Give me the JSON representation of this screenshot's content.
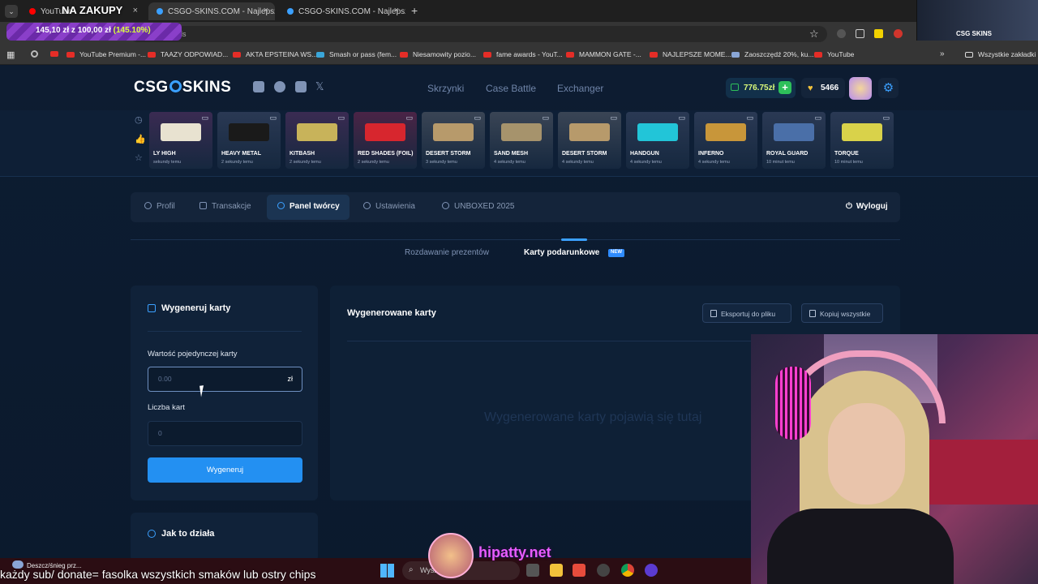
{
  "browser": {
    "tabs": [
      {
        "title": "YouTube",
        "color": "#ff0000",
        "close": "×"
      },
      {
        "title": "CSGO-SKINS.COM - Najlepsze",
        "color": "#3ba0ff",
        "close": "×"
      },
      {
        "title": "CSGO-SKINS.COM - Najlepsze",
        "color": "#3ba0ff",
        "close": "×"
      }
    ],
    "new_tab": "+",
    "url_tail": "ards",
    "bookmarks": [
      "YouTube Premium -...",
      "TAAZY ODPOWIAD...",
      "AKTA EPSTEINA WS...",
      "Smash or pass (fem...",
      "Niesamowity pozio...",
      "fame awards - YouT...",
      "MAMMON GATE -...",
      "NAJLEPSZE MOME...",
      "Zaoszczędź 20%, ku...",
      "YouTube"
    ],
    "all_bookmarks": "Wszystkie zakładki"
  },
  "overlay": {
    "title": "NA ZAKUPY",
    "donation_text": "145,10 zł z 100,00 zł",
    "donation_pct": "(145.10%)",
    "webcam_logo": "CSG SKINS",
    "weather": "Deszcz/śnieg prz...",
    "ticker": "każdy sub/ donate= fasolka wszystkich smaków lub ostry chips",
    "search_label": "Wysz",
    "streamer_name": "hipatty.net"
  },
  "site": {
    "logo": {
      "left": "CSG",
      "right": "SKINS"
    },
    "nav": [
      "Skrzynki",
      "Case Battle",
      "Exchanger"
    ],
    "balance": "776.75zł",
    "balance_plus": "+",
    "coins": "5466",
    "settings_icon": "⚙",
    "accent": "#3ba0ff"
  },
  "drops": [
    {
      "name": "LY HIGH",
      "ago": "sekundy temu",
      "color": "#3a2b52",
      "gun": "#e8e2d0"
    },
    {
      "name": "HEAVY METAL",
      "ago": "2 sekundy temu",
      "color": "#2a3954",
      "gun": "#1a1a1a"
    },
    {
      "name": "KITBASH",
      "ago": "2 sekundy temu",
      "color": "#3a2b52",
      "gun": "#c8b35a"
    },
    {
      "name": "RED SHADES (FOIL)",
      "ago": "2 sekundy temu",
      "color": "#4a2446",
      "gun": "#d7262e"
    },
    {
      "name": "DESERT STORM",
      "ago": "3 sekundy temu",
      "color": "#3a4555",
      "gun": "#b79a6b"
    },
    {
      "name": "SAND MESH",
      "ago": "4 sekundy temu",
      "color": "#3a4555",
      "gun": "#a6936c"
    },
    {
      "name": "DESERT STORM",
      "ago": "4 sekundy temu",
      "color": "#3a4555",
      "gun": "#b79a6b"
    },
    {
      "name": "HANDGUN",
      "ago": "4 sekundy temu",
      "color": "#2a3954",
      "gun": "#22c5d8"
    },
    {
      "name": "INFERNO",
      "ago": "4 sekundy temu",
      "color": "#2a3954",
      "gun": "#c8963a"
    },
    {
      "name": "ROYAL GUARD",
      "ago": "10 minut temu",
      "color": "#2a3954",
      "gun": "#4a6fa8"
    },
    {
      "name": "TORQUE",
      "ago": "10 minut temu",
      "color": "#2a3954",
      "gun": "#d9d24a"
    }
  ],
  "profile_tabs": [
    "Profil",
    "Transakcje",
    "Panel twórcy",
    "Ustawienia",
    "UNBOXED 2025"
  ],
  "logout": "Wyloguj",
  "subtabs": {
    "giveaways": "Rozdawanie prezentów",
    "giftcards": "Karty podarunkowe",
    "badge": "NEW"
  },
  "generate_card": {
    "title": "Wygeneruj karty",
    "value_label": "Wartość pojedynczej karty",
    "value_placeholder": "0.00",
    "currency": "zł",
    "count_label": "Liczba kart",
    "count_placeholder": "0",
    "button": "Wygeneruj"
  },
  "generated": {
    "title": "Wygenerowane karty",
    "export": "Eksportuj do pliku",
    "copy": "Kopiuj wszystkie",
    "empty": "Wygenerowane karty pojawią się tutaj"
  },
  "how": {
    "title": "Jak to działa"
  }
}
